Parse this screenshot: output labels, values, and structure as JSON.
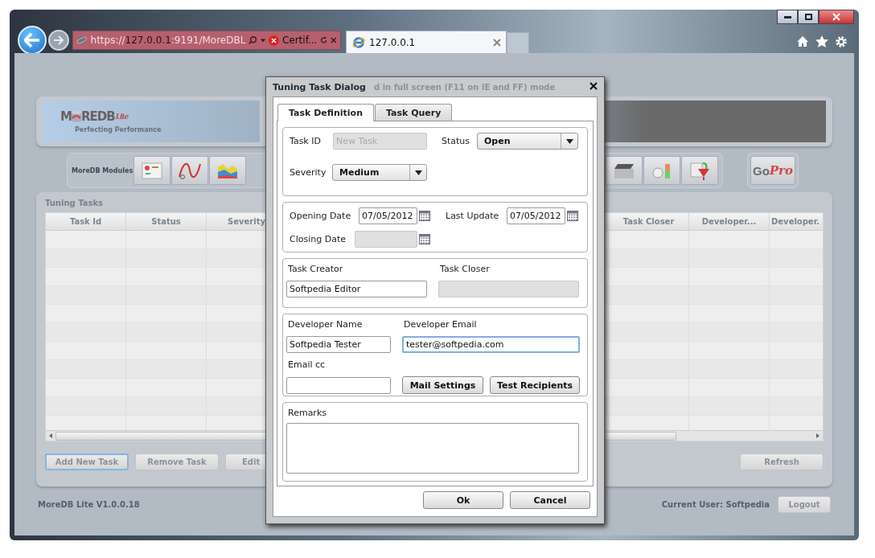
{
  "browser": {
    "address": {
      "scheme": "https://",
      "host": "127.0.0.1",
      "path": ":9191/MoreDBL"
    },
    "cert_error": "Certif...",
    "tabs": [
      {
        "title": "127.0.0.1",
        "selected": true
      }
    ]
  },
  "app": {
    "logo": {
      "left": "M",
      "right": "REDB",
      "suffix": "Lite",
      "tagline": "Perfecting Performance"
    },
    "modules_label": "MoreDB Modules",
    "go_pro": {
      "go": "Go",
      "pro": "Pro"
    },
    "tasks": {
      "title": "Tuning Tasks",
      "columns": [
        "Task Id",
        "Status",
        "Severity",
        "Task Closer",
        "Developer...",
        "Developer."
      ],
      "buttons": [
        {
          "label": "Add New Task",
          "focused": true
        },
        {
          "label": "Remove Task",
          "focused": false
        },
        {
          "label": "Edit",
          "focused": false
        }
      ],
      "refresh": "Refresh"
    },
    "version": "MoreDB Lite V1.0.0.18",
    "current_user": "Current User: Softpedia",
    "logout": "Logout"
  },
  "dialog": {
    "title": "Tuning Task Dialog",
    "notice": "d in full screen (F11 on IE and FF) mode",
    "tabs": [
      {
        "label": "Task Definition",
        "selected": true
      },
      {
        "label": "Task Query",
        "selected": false
      }
    ],
    "task_id": {
      "label": "Task ID",
      "placeholder": "New Task",
      "disabled": true
    },
    "status": {
      "label": "Status",
      "value": "Open"
    },
    "severity": {
      "label": "Severity",
      "value": "Medium"
    },
    "opening_date": {
      "label": "Opening Date",
      "value": "07/05/2012"
    },
    "last_update": {
      "label": "Last Update",
      "value": "07/05/2012"
    },
    "closing_date": {
      "label": "Closing Date",
      "disabled": true
    },
    "task_creator": {
      "label": "Task Creator",
      "value": "Softpedia Editor"
    },
    "task_closer": {
      "label": "Task Closer",
      "disabled": true
    },
    "developer_name": {
      "label": "Developer Name",
      "value": "Softpedia Tester",
      "focused": false
    },
    "developer_email": {
      "label": "Developer Email",
      "value": "tester@softpedia.com",
      "focused": true
    },
    "email_cc": {
      "label": "Email cc"
    },
    "mail_settings": "Mail Settings",
    "test_recipients": "Test Recipients",
    "remarks": {
      "label": "Remarks"
    },
    "buttons": [
      "Ok",
      "Cancel"
    ]
  }
}
